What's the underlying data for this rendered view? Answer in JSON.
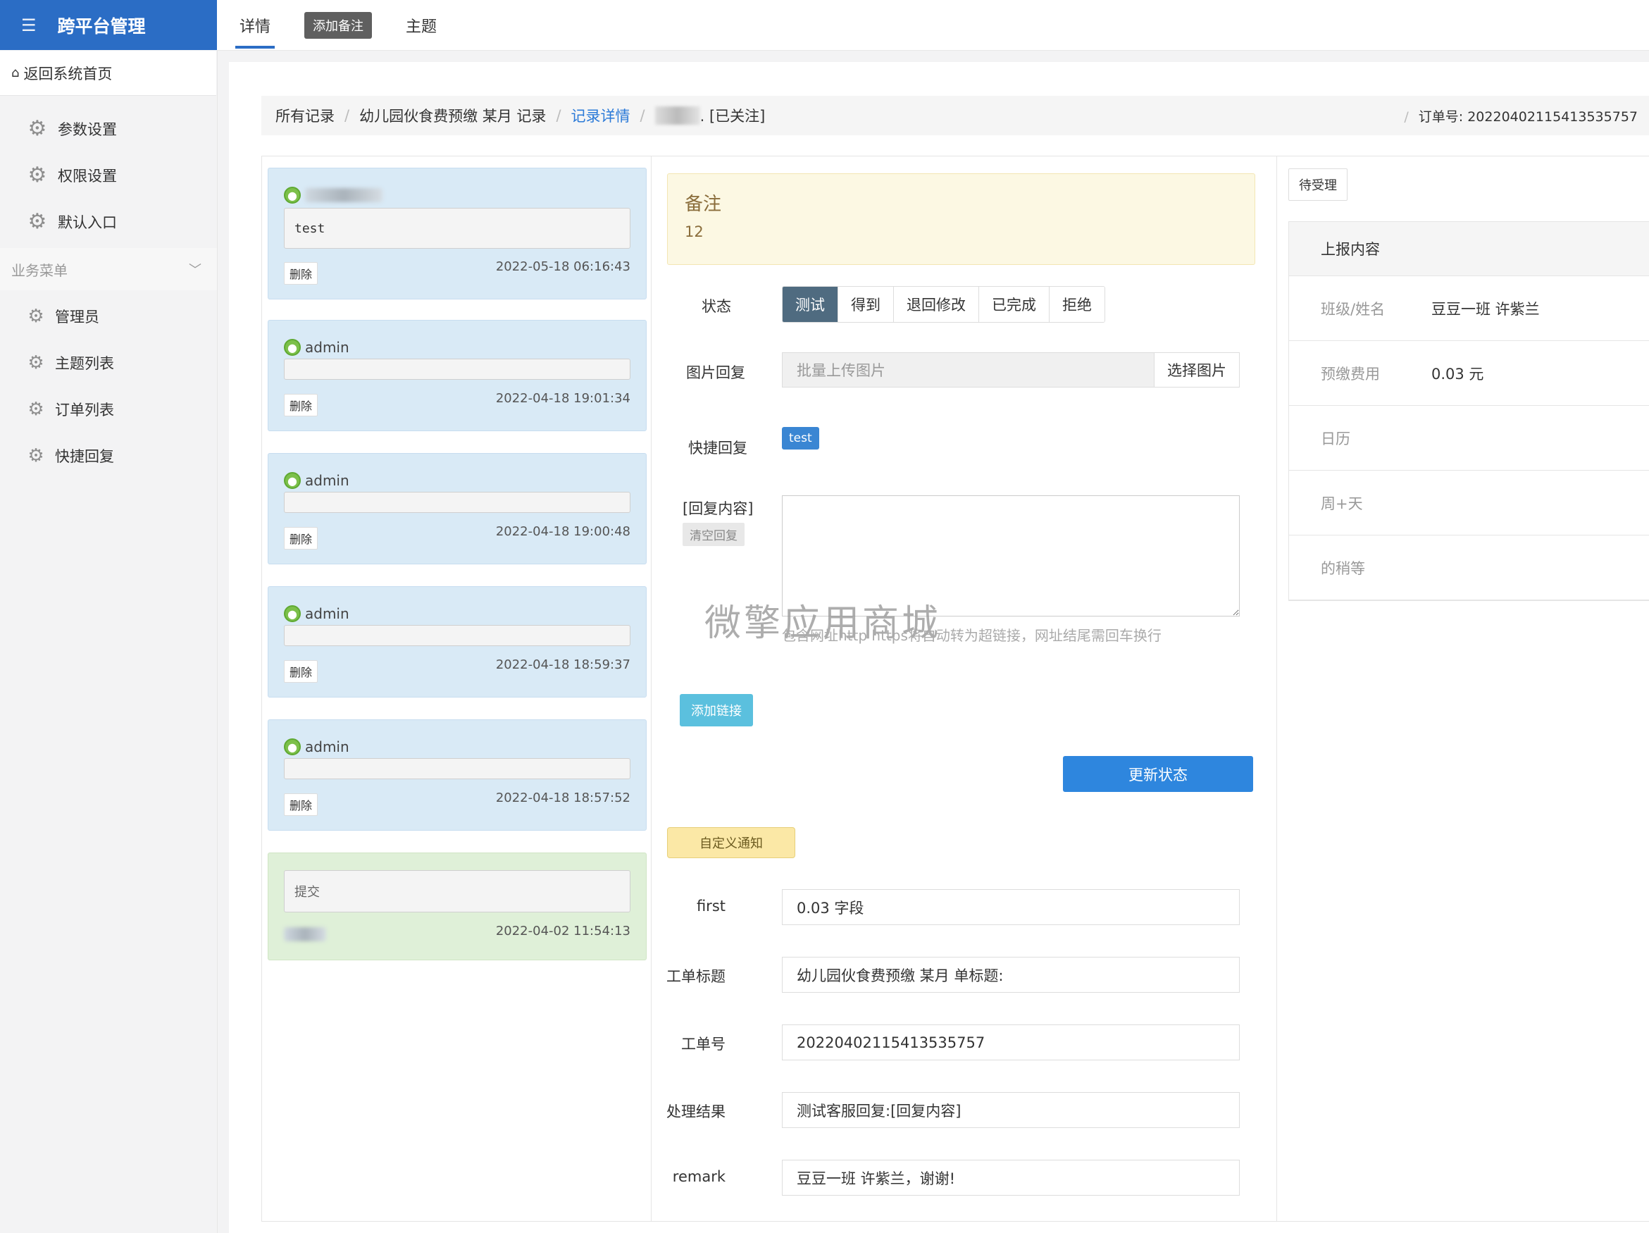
{
  "app": {
    "title": "跨平台管理"
  },
  "sidebar": {
    "home": "返回系统首页",
    "top_items": [
      {
        "label": "参数设置",
        "icon": "gear-icon"
      },
      {
        "label": "权限设置",
        "icon": "gear-icon"
      },
      {
        "label": "默认入口",
        "icon": "gear-icon"
      }
    ],
    "section": "业务菜单",
    "items": [
      {
        "label": "管理员",
        "icon": "gear-icon"
      },
      {
        "label": "主题列表",
        "icon": "gear-icon"
      },
      {
        "label": "订单列表",
        "icon": "gear-icon"
      },
      {
        "label": "快捷回复",
        "icon": "gear-icon"
      }
    ]
  },
  "tabs": {
    "detail": "详情",
    "add_note": "添加备注",
    "theme": "主题"
  },
  "breadcrumb": {
    "all": "所有记录",
    "record": "幼儿园伙食费预缴 某月 记录",
    "detail": "记录详情",
    "followed": ". [已关注]",
    "order_no": "订单号: 20220402115413535757"
  },
  "messages": [
    {
      "author": "",
      "content": "test",
      "delete": "删除",
      "time": "2022-05-18 06:16:43"
    },
    {
      "author": "admin",
      "content": "",
      "delete": "删除",
      "time": "2022-04-18 19:01:34"
    },
    {
      "author": "admin",
      "content": "",
      "delete": "删除",
      "time": "2022-04-18 19:00:48"
    },
    {
      "author": "admin",
      "content": "",
      "delete": "删除",
      "time": "2022-04-18 18:59:37"
    },
    {
      "author": "admin",
      "content": "",
      "delete": "删除",
      "time": "2022-04-18 18:57:52"
    }
  ],
  "submit_card": {
    "content": "提交",
    "time": "2022-04-02 11:54:13"
  },
  "note": {
    "title": "备注",
    "value": "12"
  },
  "form": {
    "status_label": "状态",
    "status_options": [
      "测试",
      "得到",
      "退回修改",
      "已完成",
      "拒绝"
    ],
    "status_selected": "测试",
    "image_label": "图片回复",
    "image_placeholder": "批量上传图片",
    "image_button": "选择图片",
    "quick_label": "快捷回复",
    "quick_tag": "test",
    "reply_label": "[回复内容]",
    "clear_button": "清空回复",
    "watermark": "微擎应用商城",
    "hint": "包含网址http https将自动转为超链接，网址结尾需回车换行",
    "add_link": "添加链接",
    "update_button": "更新状态",
    "custom_notice": "自定义通知"
  },
  "fields": [
    {
      "label": "first",
      "value": "0.03 字段"
    },
    {
      "label": "工单标题",
      "value": "幼儿园伙食费预缴 某月 单标题:"
    },
    {
      "label": "工单号",
      "value": "20220402115413535757"
    },
    {
      "label": "处理结果",
      "value": "测试客服回复:[回复内容]"
    },
    {
      "label": "remark",
      "value": "豆豆一班 许紫兰，谢谢!"
    }
  ],
  "right": {
    "pending": "待受理",
    "report_title": "上报内容",
    "rows": [
      {
        "k": "班级/姓名",
        "v": "豆豆一班 许紫兰"
      },
      {
        "k": "预缴费用",
        "v": "0.03 元"
      },
      {
        "k": "日历",
        "v": ""
      },
      {
        "k": "周+天",
        "v": ""
      },
      {
        "k": "的稍等",
        "v": ""
      }
    ]
  },
  "colors": {
    "brand": "#2b6dc5",
    "accent": "#2e86de",
    "selected_status": "#4f6b80"
  }
}
